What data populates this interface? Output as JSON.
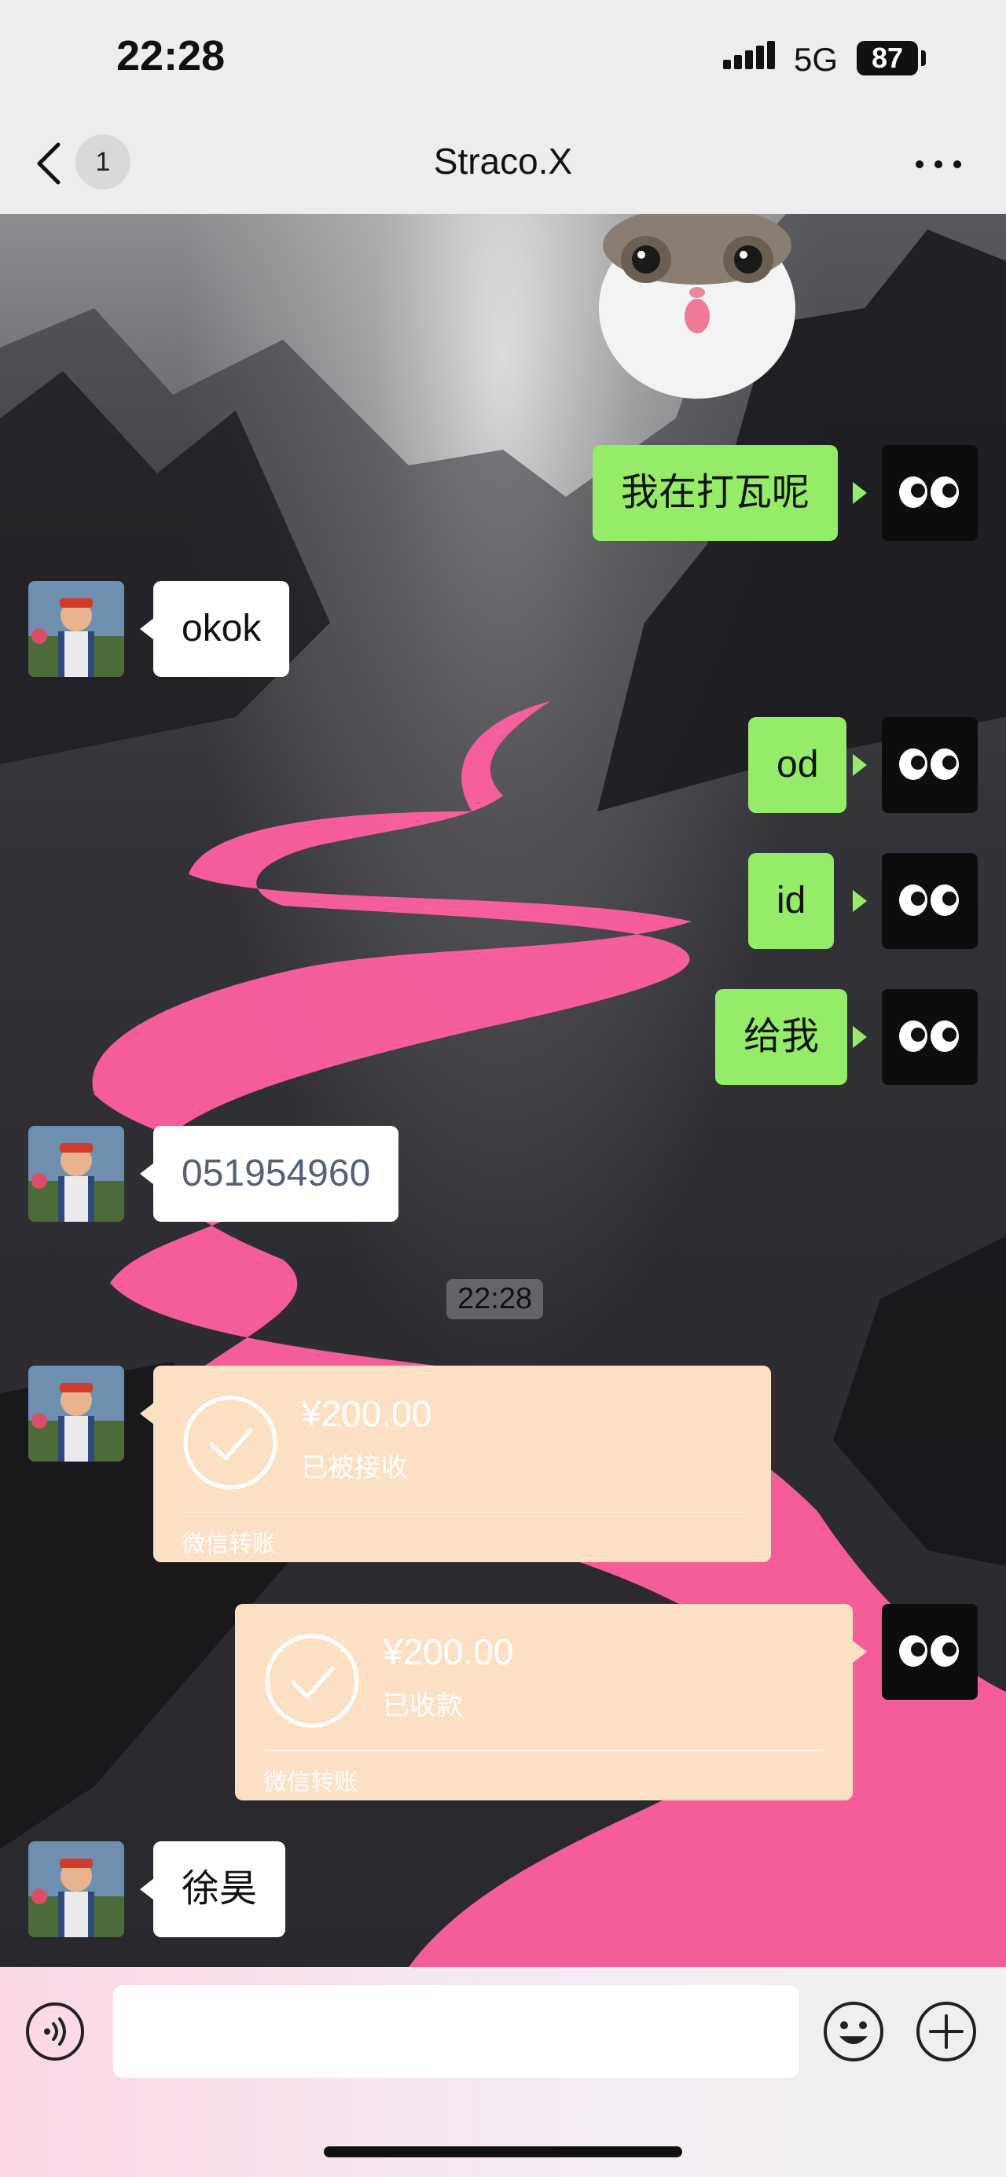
{
  "status_bar": {
    "time": "22:28",
    "network": "5G",
    "battery": "87"
  },
  "nav": {
    "unread_count": "1",
    "title": "Straco.X"
  },
  "messages": [
    {
      "side": "right",
      "type": "text",
      "text": "我在打瓦呢"
    },
    {
      "side": "left",
      "type": "text",
      "text": "okok"
    },
    {
      "side": "right",
      "type": "text",
      "text": "od"
    },
    {
      "side": "right",
      "type": "text",
      "text": "id"
    },
    {
      "side": "right",
      "type": "text",
      "text": "给我"
    },
    {
      "side": "left",
      "type": "text",
      "text": "051954960"
    },
    {
      "type": "timestamp",
      "text": "22:28"
    },
    {
      "side": "left",
      "type": "transfer",
      "amount": "¥200.00",
      "status": "已被接收",
      "footer": "微信转账"
    },
    {
      "side": "right",
      "type": "transfer",
      "amount": "¥200.00",
      "status": "已收款",
      "footer": "微信转账"
    },
    {
      "side": "left",
      "type": "text",
      "text": "徐昊"
    }
  ],
  "colors": {
    "outgoing_bubble": "#95ec69",
    "incoming_bubble": "#ffffff",
    "transfer_card": "#fbe0c4",
    "river": "#ff5fa0"
  },
  "icons": {
    "back": "chevron-left-icon",
    "more": "more-dots-icon",
    "voice": "voice-icon",
    "emoji": "emoji-icon",
    "plus": "plus-icon",
    "sticker": "cat-sticker",
    "my_avatar": "eyes-avatar"
  }
}
